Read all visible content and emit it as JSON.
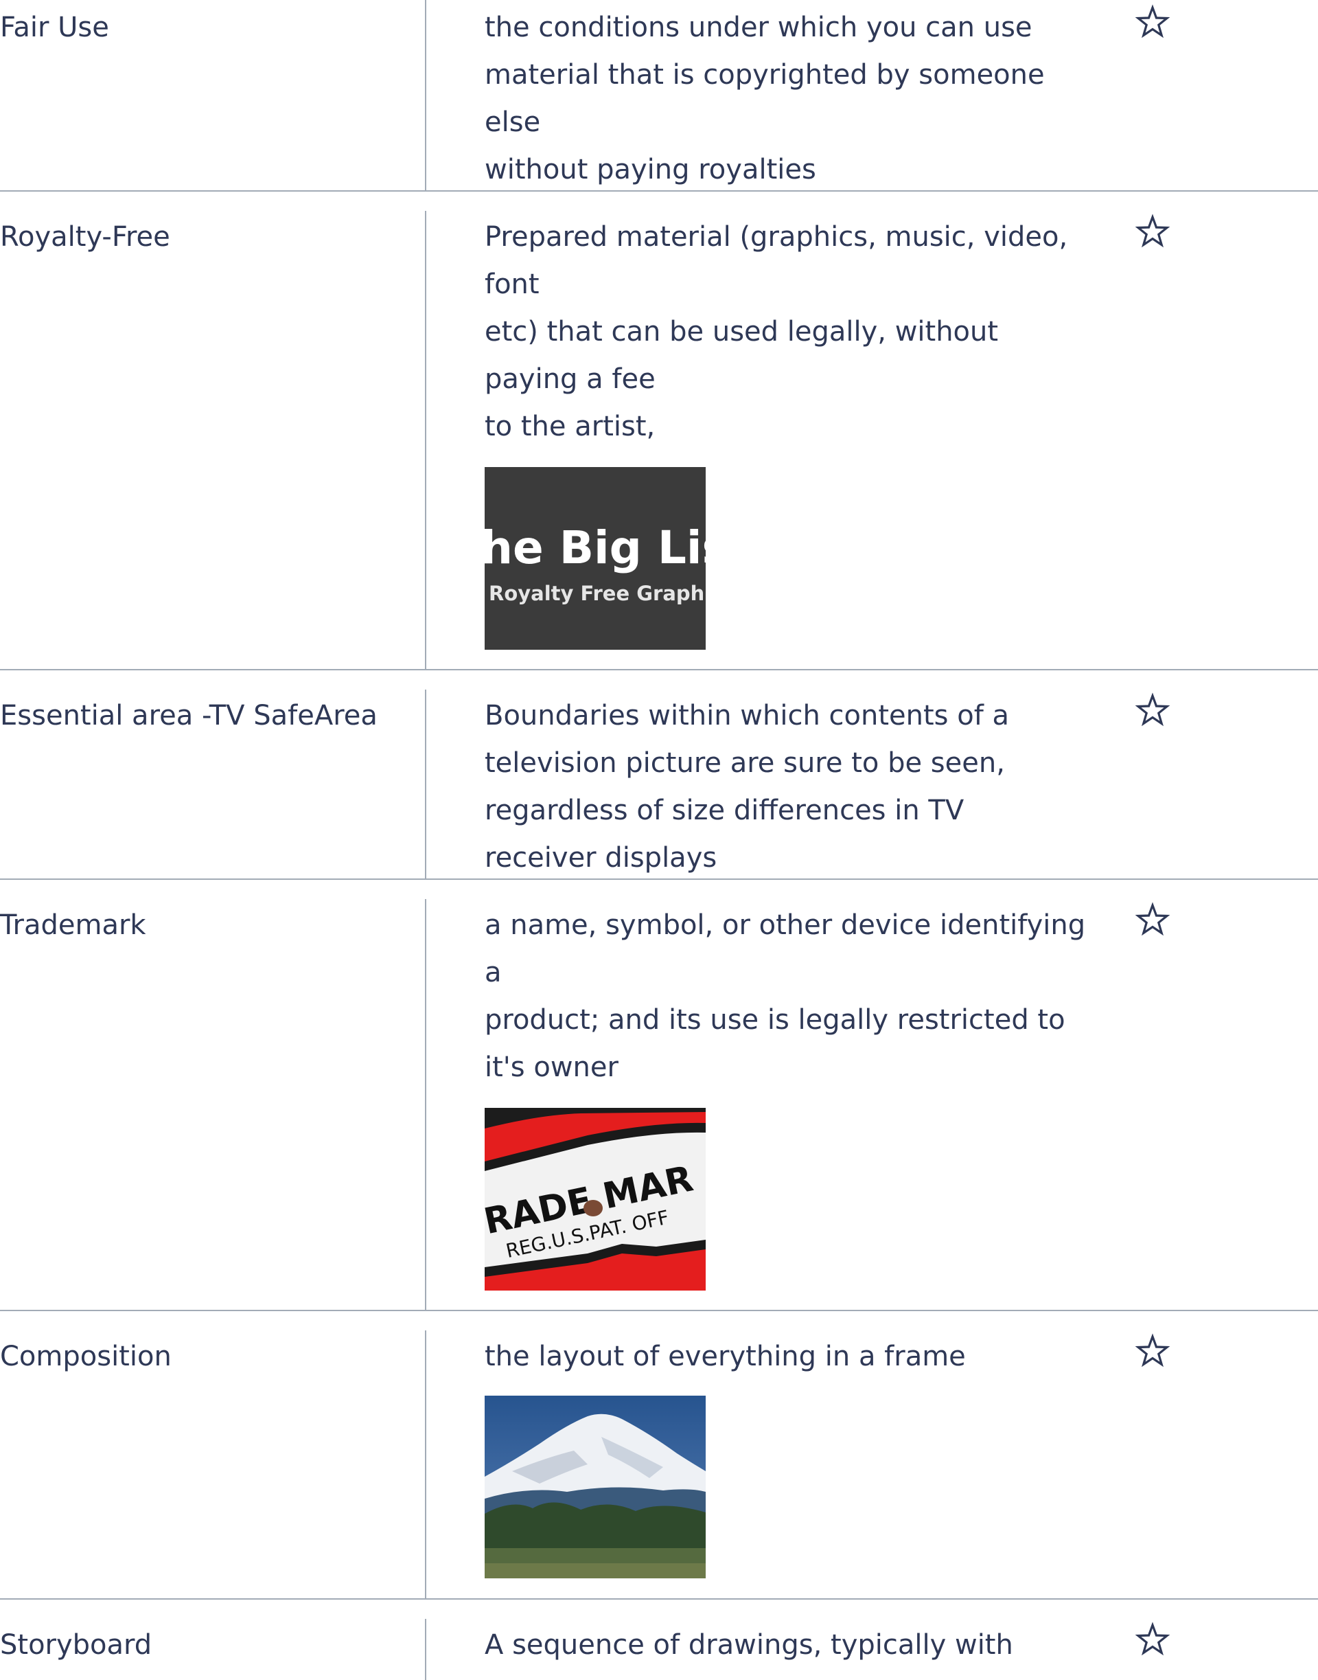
{
  "cards": [
    {
      "term": "Fair Use",
      "definition_lines": [
        "the conditions under which you can use",
        "material that is copyrighted by someone",
        "else",
        "without paying royalties"
      ]
    },
    {
      "term": "Royalty-Free",
      "definition_lines": [
        "Prepared material (graphics, music, video,",
        "font",
        "etc) that can be used legally, without",
        "paying a fee",
        "to the artist,"
      ],
      "image_text_line1": "he Big Lis",
      "image_text_line2": "Royalty Free Graphi"
    },
    {
      "term": "Essential area -TV SafeArea",
      "definition_lines": [
        "Boundaries within which contents of a",
        "television picture are sure to be seen,",
        "regardless of size differences in TV",
        "receiver displays"
      ]
    },
    {
      "term": "Trademark",
      "definition_lines": [
        "a name, symbol, or other device identifying",
        "a",
        "product; and its use is legally restricted to",
        "it's owner"
      ],
      "image_text_line1": "RADE MAR",
      "image_text_line2": "REG.U.S.PAT. OFF"
    },
    {
      "term": "Composition",
      "definition_lines": [
        "the layout of everything in a frame"
      ]
    },
    {
      "term": "Storyboard",
      "definition_lines": [
        "A sequence of drawings, typically with"
      ]
    }
  ],
  "icons": {
    "star": "star-outline-icon"
  },
  "colors": {
    "text": "#2e3856",
    "divider": "#a2abb6",
    "star": "#2e3856"
  }
}
